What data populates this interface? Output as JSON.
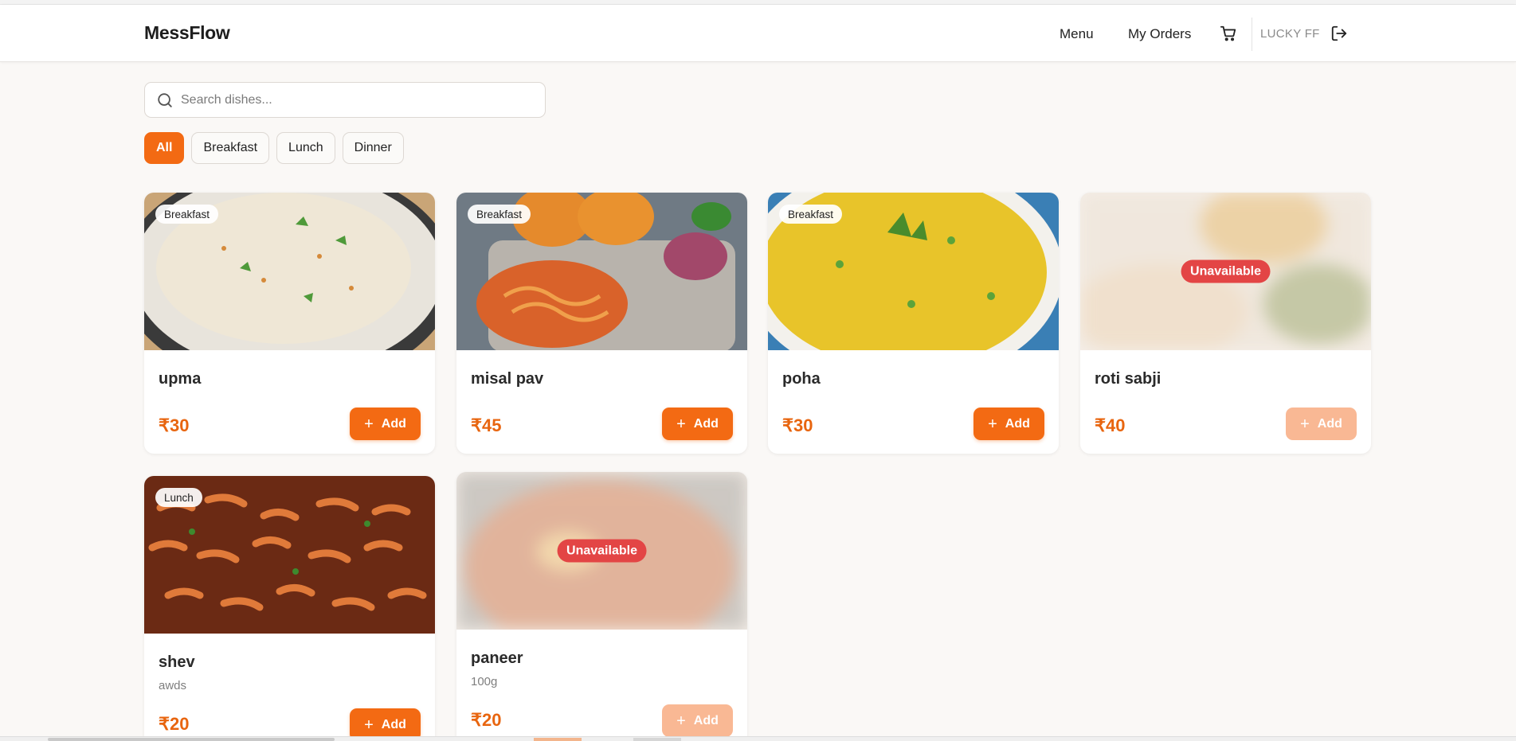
{
  "header": {
    "brand": "MessFlow",
    "nav": {
      "menu": "Menu",
      "orders": "My Orders"
    },
    "user": "LUCKY FF"
  },
  "search": {
    "placeholder": "Search dishes...",
    "value": ""
  },
  "filters": {
    "items": [
      {
        "label": "All",
        "active": true
      },
      {
        "label": "Breakfast",
        "active": false
      },
      {
        "label": "Lunch",
        "active": false
      },
      {
        "label": "Dinner",
        "active": false
      }
    ]
  },
  "dishes": [
    {
      "name": "upma",
      "category": "Breakfast",
      "price": "₹30",
      "add": "Add",
      "available": true
    },
    {
      "name": "misal pav",
      "category": "Breakfast",
      "price": "₹45",
      "add": "Add",
      "available": true
    },
    {
      "name": "poha",
      "category": "Breakfast",
      "price": "₹30",
      "add": "Add",
      "available": true
    },
    {
      "name": "roti sabji",
      "category": "",
      "price": "₹40",
      "add": "Add",
      "available": false,
      "status": "Unavailable"
    },
    {
      "name": "shev",
      "category": "Lunch",
      "description": "awds",
      "price": "₹20",
      "add": "Add",
      "available": true
    },
    {
      "name": "paneer",
      "category": "",
      "description": "100g",
      "price": "₹20",
      "add": "Add",
      "available": false,
      "status": "Unavailable"
    }
  ],
  "colors": {
    "accent": "#f36a13",
    "price": "#e8650f",
    "unavailable": "#e34545",
    "background": "#faf8f6"
  }
}
